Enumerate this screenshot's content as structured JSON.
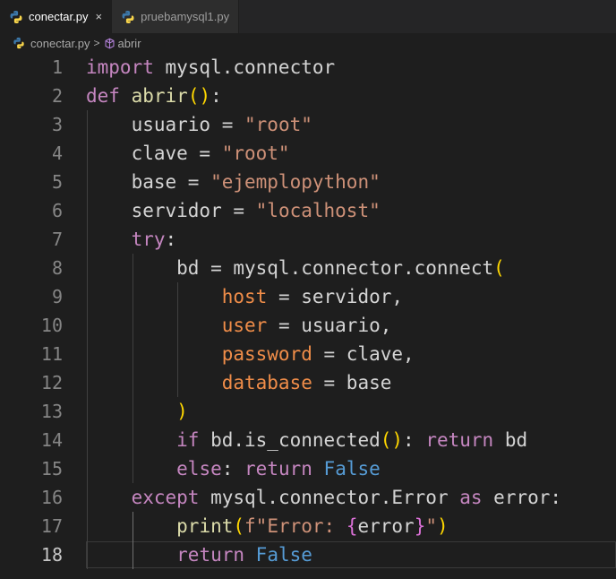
{
  "tabs": [
    {
      "label": "conectar.py",
      "active": true,
      "close": "×"
    },
    {
      "label": "pruebamysql1.py",
      "active": false
    }
  ],
  "breadcrumbs": {
    "file": "conectar.py",
    "separator": ">",
    "symbol": "abrir"
  },
  "editor": {
    "active_line": 18,
    "line_numbers": [
      "1",
      "2",
      "3",
      "4",
      "5",
      "6",
      "7",
      "8",
      "9",
      "10",
      "11",
      "12",
      "13",
      "14",
      "15",
      "16",
      "17",
      "18"
    ],
    "lines": [
      [
        [
          "kw",
          "import"
        ],
        [
          "plain",
          " mysql.connector"
        ]
      ],
      [
        [
          "kw",
          "def"
        ],
        [
          "plain",
          " "
        ],
        [
          "fn",
          "abrir"
        ],
        [
          "p1",
          "()"
        ],
        [
          "plain",
          ":"
        ]
      ],
      [
        [
          "plain",
          "    usuario = "
        ],
        [
          "str",
          "\"root\""
        ]
      ],
      [
        [
          "plain",
          "    clave = "
        ],
        [
          "str",
          "\"root\""
        ]
      ],
      [
        [
          "plain",
          "    base = "
        ],
        [
          "str",
          "\"ejemplopython\""
        ]
      ],
      [
        [
          "plain",
          "    servidor = "
        ],
        [
          "str",
          "\"localhost\""
        ]
      ],
      [
        [
          "plain",
          "    "
        ],
        [
          "kw",
          "try"
        ],
        [
          "plain",
          ":"
        ]
      ],
      [
        [
          "plain",
          "        bd = mysql.connector.connect"
        ],
        [
          "p1",
          "("
        ]
      ],
      [
        [
          "plain",
          "            "
        ],
        [
          "param",
          "host"
        ],
        [
          "plain",
          " = servidor,"
        ]
      ],
      [
        [
          "plain",
          "            "
        ],
        [
          "param",
          "user"
        ],
        [
          "plain",
          " = usuario,"
        ]
      ],
      [
        [
          "plain",
          "            "
        ],
        [
          "param",
          "password"
        ],
        [
          "plain",
          " = clave,"
        ]
      ],
      [
        [
          "plain",
          "            "
        ],
        [
          "param",
          "database"
        ],
        [
          "plain",
          " = base"
        ]
      ],
      [
        [
          "plain",
          "        "
        ],
        [
          "p1",
          ")"
        ]
      ],
      [
        [
          "plain",
          "        "
        ],
        [
          "kw",
          "if"
        ],
        [
          "plain",
          " bd.is_connected"
        ],
        [
          "p1",
          "()"
        ],
        [
          "plain",
          ": "
        ],
        [
          "kw",
          "return"
        ],
        [
          "plain",
          " bd"
        ]
      ],
      [
        [
          "plain",
          "        "
        ],
        [
          "kw",
          "else"
        ],
        [
          "plain",
          ": "
        ],
        [
          "kw",
          "return"
        ],
        [
          "plain",
          " "
        ],
        [
          "const",
          "False"
        ]
      ],
      [
        [
          "plain",
          "    "
        ],
        [
          "kw",
          "except"
        ],
        [
          "plain",
          " mysql.connector.Error "
        ],
        [
          "kw",
          "as"
        ],
        [
          "plain",
          " error:"
        ]
      ],
      [
        [
          "plain",
          "        "
        ],
        [
          "fn",
          "print"
        ],
        [
          "p1",
          "("
        ],
        [
          "str",
          "f\"Error: "
        ],
        [
          "p2",
          "{"
        ],
        [
          "plain",
          "error"
        ],
        [
          "p2",
          "}"
        ],
        [
          "str",
          "\""
        ],
        [
          "p1",
          ")"
        ]
      ],
      [
        [
          "plain",
          "        "
        ],
        [
          "kw",
          "return"
        ],
        [
          "plain",
          " "
        ],
        [
          "const",
          "False"
        ]
      ]
    ]
  }
}
